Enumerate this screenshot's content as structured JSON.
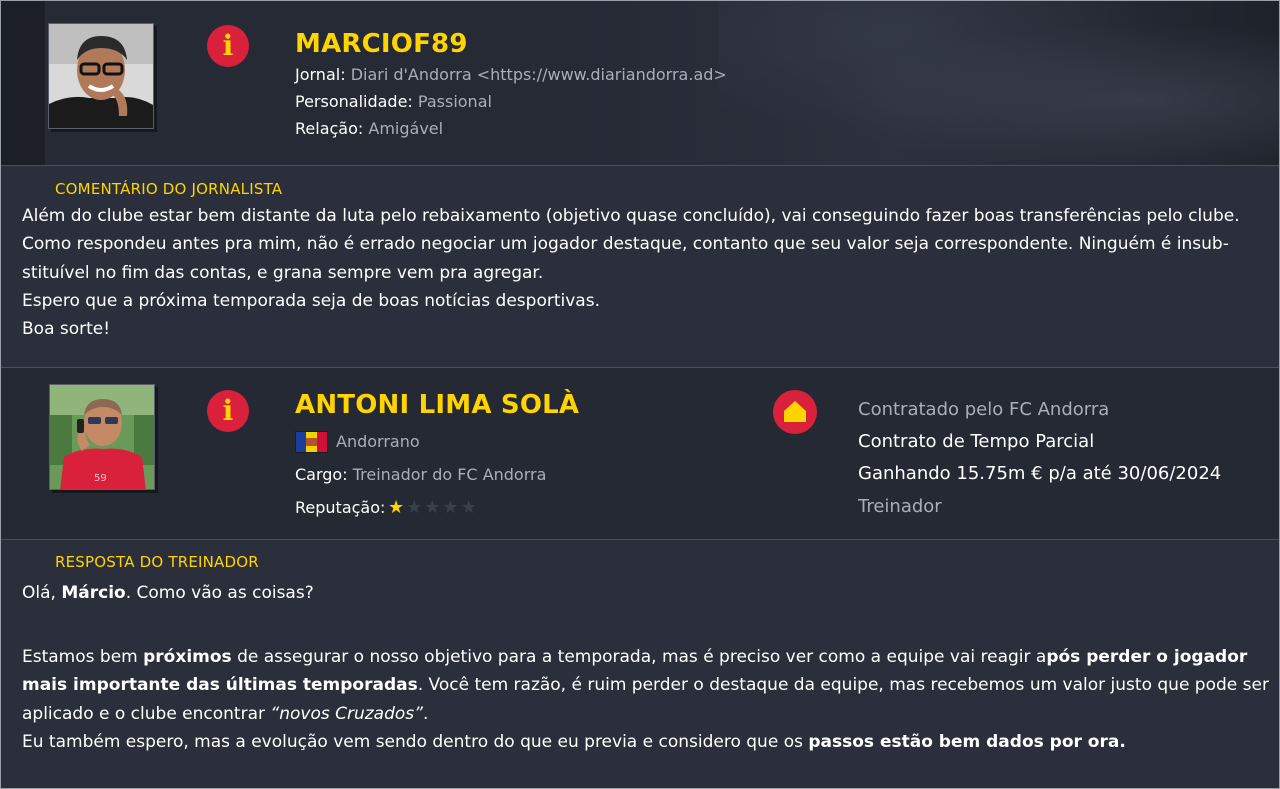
{
  "journalist": {
    "name": "MARCIOF89",
    "newspaper_label": "Jornal:",
    "newspaper_value": "Diari d'Andorra <https://www.diariandorra.ad>",
    "personality_label": "Personalidade:",
    "personality_value": "Passional",
    "relation_label": "Relação:",
    "relation_value": "Amigável",
    "info_icon": "info-icon"
  },
  "journalist_comment": {
    "title": "COMENTÁRIO DO JORNALISTA",
    "lines": [
      "Além do clube estar bem distante da luta pelo rebaixamento (objetivo quase concluído), vai conseguindo fazer boas transferências pelo clube.",
      "Como respondeu antes pra mim, não é errado negociar um jogador destaque, contanto que seu valor seja correspondente. Ninguém é insub-",
      "stituível no fim das contas, e grana sempre vem pra agregar.",
      "Espero que a próxima temporada seja de boas notícias desportivas.",
      "Boa sorte!"
    ]
  },
  "coach": {
    "name": "ANTONI LIMA SOLÀ",
    "nationality": "Andorrano",
    "role_label": "Cargo:",
    "role_value": "Treinador do FC Andorra",
    "reputation_label": "Reputação:",
    "reputation_stars": 1,
    "reputation_max": 5,
    "info_icon": "info-icon",
    "home_icon": "home-icon",
    "contract": {
      "line1": "Contratado pelo FC Andorra",
      "line2": "Contrato de Tempo Parcial",
      "line3": "Ganhando 15.75m € p/a até 30/06/2024",
      "line4": "Treinador"
    }
  },
  "coach_response": {
    "title": "RESPOSTA DO TREINADOR",
    "p1_a": "Olá, ",
    "p1_b": "Márcio",
    "p1_c": ". Como vão as coisas?",
    "p2_a": "Estamos bem ",
    "p2_b": "próximos",
    "p2_c": " de assegurar o nosso objetivo para a temporada, mas é preciso ver como a equipe vai reagir a",
    "p2_d": "pós perder o jogador",
    "p2_e": "mais importante das últimas temporadas",
    "p2_f": ". Você tem razão, é ruim perder o destaque da equipe, mas recebemos um valor justo que pode ser",
    "p2_g": "aplicado e o clube encontrar ",
    "p2_h": "“novos Cruzados”",
    "p2_i": ".",
    "p3_a": "Eu também espero, mas a evolução vem sendo dentro do que eu previa e considero que os ",
    "p3_b": "passos estão bem dados por ora."
  },
  "colors": {
    "accent_yellow": "#ffd400",
    "badge_red": "#d9213b",
    "muted_text": "#a9aeb8",
    "background": "#2b2f3b"
  }
}
